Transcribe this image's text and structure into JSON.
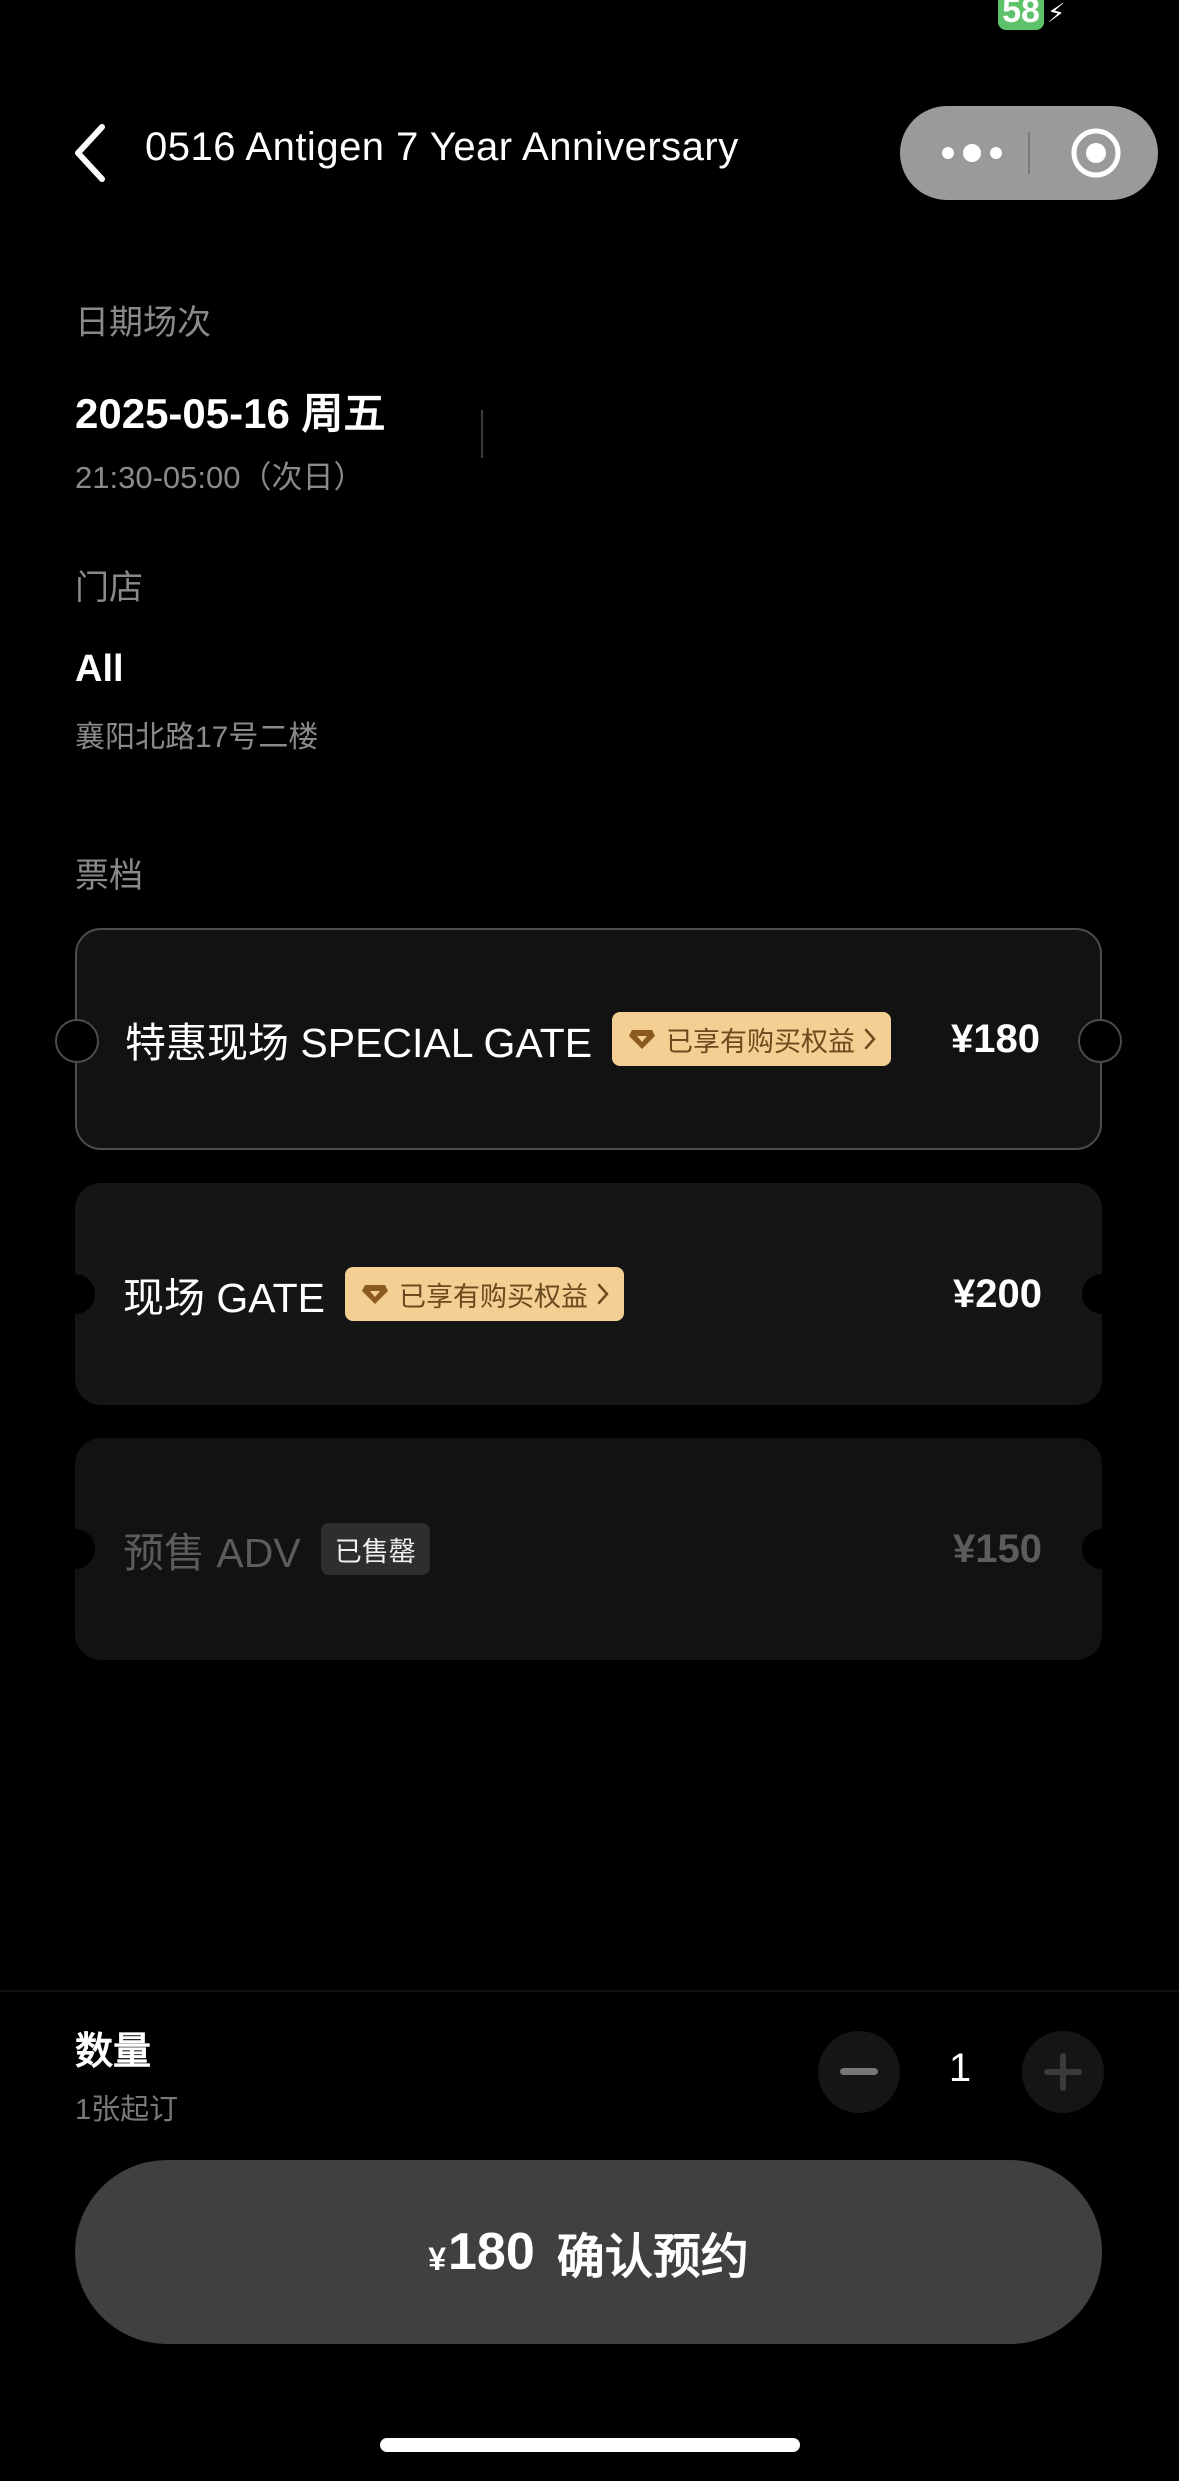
{
  "status_bar": {
    "battery_level": "58"
  },
  "header": {
    "title": "0516 Antigen 7 Year Anniversary"
  },
  "date_section": {
    "label": "日期场次",
    "date": "2025-05-16 周五",
    "time": "21:30-05:00（次日）"
  },
  "store_section": {
    "label": "门店",
    "name": "All",
    "address": "襄阳北路17号二楼"
  },
  "ticket_section": {
    "label": "票档",
    "tickets": [
      {
        "name": "特惠现场 SPECIAL GATE",
        "perk": "已享有购买权益",
        "price": "¥180",
        "selected": true
      },
      {
        "name": "现场 GATE",
        "perk": "已享有购买权益",
        "price": "¥200",
        "selected": false
      },
      {
        "name": "预售 ADV",
        "sold_out": "已售罄",
        "price": "¥150",
        "disabled": true
      }
    ]
  },
  "quantity": {
    "label": "数量",
    "min_note": "1张起订",
    "value": "1"
  },
  "confirm": {
    "currency": "¥",
    "amount": "180",
    "label": "确认预约"
  },
  "colors": {
    "background": "#000000",
    "perk_badge": "#f3cf93",
    "perk_text": "#6b4a1e",
    "confirm_button": "#404040",
    "battery": "#5ec26a"
  },
  "icons": {
    "back": "chevron-left-icon",
    "more": "more-dots-icon",
    "close": "target-icon",
    "perk": "diamond-icon",
    "perk_arrow": "chevron-right-icon",
    "minus": "minus-icon",
    "plus": "plus-icon"
  }
}
